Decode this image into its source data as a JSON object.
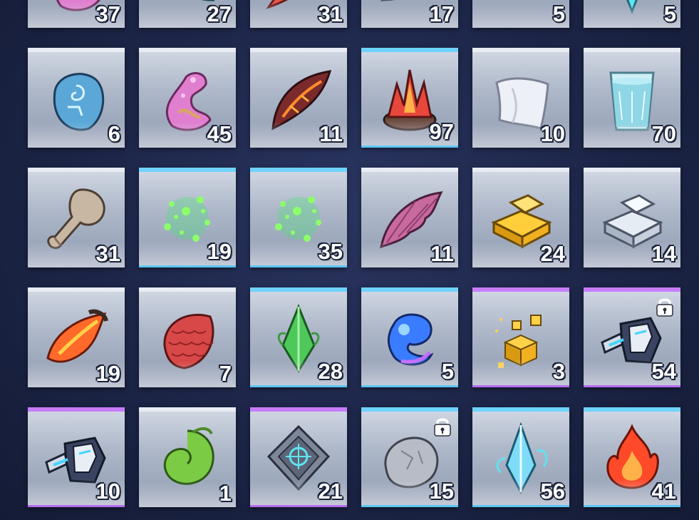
{
  "inventory": {
    "rows": [
      [
        {
          "count": "37",
          "icon": "pink-tentacle-icon",
          "rarity": "white"
        },
        {
          "count": "27",
          "icon": "teal-claw-icon",
          "rarity": "white"
        },
        {
          "count": "31",
          "icon": "red-feather-icon",
          "rarity": "white"
        },
        {
          "count": "17",
          "icon": "steel-horn-icon",
          "rarity": "white"
        },
        {
          "count": "5",
          "icon": "green-leaf-icon",
          "rarity": "white"
        },
        {
          "count": "5",
          "icon": "cyan-crystal-icon",
          "rarity": "white"
        }
      ],
      [
        {
          "count": "6",
          "icon": "rune-stone-icon",
          "rarity": "white"
        },
        {
          "count": "45",
          "icon": "pink-tentacle-icon",
          "rarity": "white"
        },
        {
          "count": "11",
          "icon": "lava-wing-icon",
          "rarity": "white"
        },
        {
          "count": "97",
          "icon": "fire-crystal-icon",
          "rarity": "blue"
        },
        {
          "count": "10",
          "icon": "cloth-icon",
          "rarity": "white"
        },
        {
          "count": "70",
          "icon": "water-glass-icon",
          "rarity": "white"
        }
      ],
      [
        {
          "count": "31",
          "icon": "bone-club-icon",
          "rarity": "white"
        },
        {
          "count": "19",
          "icon": "green-sparkle-icon",
          "rarity": "blue"
        },
        {
          "count": "35",
          "icon": "green-sparkle-icon",
          "rarity": "blue"
        },
        {
          "count": "11",
          "icon": "bat-wing-icon",
          "rarity": "white"
        },
        {
          "count": "24",
          "icon": "gold-ingot-icon",
          "rarity": "white"
        },
        {
          "count": "14",
          "icon": "silver-ingot-icon",
          "rarity": "white"
        }
      ],
      [
        {
          "count": "19",
          "icon": "flame-feather-icon",
          "rarity": "white"
        },
        {
          "count": "7",
          "icon": "red-scale-icon",
          "rarity": "white"
        },
        {
          "count": "28",
          "icon": "green-crystal-icon",
          "rarity": "blue"
        },
        {
          "count": "5",
          "icon": "blue-flame-icon",
          "rarity": "blue"
        },
        {
          "count": "3",
          "icon": "gold-cubes-icon",
          "rarity": "purple"
        },
        {
          "count": "54",
          "icon": "mech-gauntlet-icon",
          "rarity": "purple",
          "locked": true
        }
      ],
      [
        {
          "count": "10",
          "icon": "mech-gauntlet-icon",
          "rarity": "purple"
        },
        {
          "count": "1",
          "icon": "green-swirl-icon",
          "rarity": "white"
        },
        {
          "count": "21",
          "icon": "rune-plate-icon",
          "rarity": "purple"
        },
        {
          "count": "15",
          "icon": "grey-rock-icon",
          "rarity": "blue",
          "locked": true
        },
        {
          "count": "56",
          "icon": "ice-crystal-icon",
          "rarity": "blue"
        },
        {
          "count": "41",
          "icon": "red-fire-icon",
          "rarity": "blue"
        }
      ]
    ]
  }
}
